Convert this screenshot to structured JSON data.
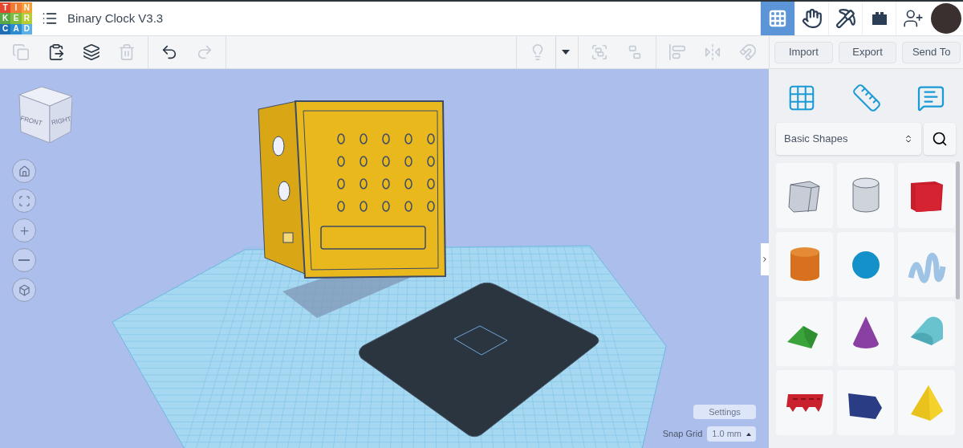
{
  "header": {
    "logo_letters": [
      {
        "text": "T",
        "color": "#e4462e"
      },
      {
        "text": "I",
        "color": "#f07c33"
      },
      {
        "text": "N",
        "color": "#f59e38"
      },
      {
        "text": "K",
        "color": "#5aa845"
      },
      {
        "text": "E",
        "color": "#7dbd3f"
      },
      {
        "text": "R",
        "color": "#b7cc35"
      },
      {
        "text": "C",
        "color": "#1f6fb8"
      },
      {
        "text": "A",
        "color": "#2d8bd2"
      },
      {
        "text": "D",
        "color": "#5bb0e4"
      }
    ],
    "title": "Binary Clock V3.3",
    "mode_tabs": [
      {
        "kind": "grid",
        "selected": true
      },
      {
        "kind": "sim",
        "selected": false
      },
      {
        "kind": "blocks",
        "selected": false
      },
      {
        "kind": "bricks",
        "selected": false
      },
      {
        "kind": "invite",
        "selected": false
      }
    ]
  },
  "toolbar": {
    "left_groups": [
      [
        {
          "kind": "copy",
          "disabled": true
        },
        {
          "kind": "paste",
          "disabled": false
        },
        {
          "kind": "duplicate",
          "disabled": false
        },
        {
          "kind": "delete",
          "disabled": true
        }
      ],
      [
        {
          "kind": "undo",
          "disabled": false
        },
        {
          "kind": "redo",
          "disabled": true
        }
      ]
    ],
    "right_groups": [
      [
        {
          "kind": "light",
          "disabled": true
        },
        {
          "kind": "light-menu",
          "disabled": false
        }
      ],
      [
        {
          "kind": "group",
          "disabled": true
        },
        {
          "kind": "ungroup",
          "disabled": true
        }
      ],
      [
        {
          "kind": "align",
          "disabled": true
        },
        {
          "kind": "mirror",
          "disabled": true
        },
        {
          "kind": "magnet",
          "disabled": true
        }
      ]
    ],
    "actions": [
      "Import",
      "Export",
      "Send To"
    ]
  },
  "view_cube": {
    "faces": [
      "FRONT",
      "RIGHT"
    ]
  },
  "view_controls": [
    {
      "kind": "home"
    },
    {
      "kind": "fit"
    },
    {
      "kind": "zoom-in"
    },
    {
      "kind": "zoom-out"
    },
    {
      "kind": "perspective"
    }
  ],
  "grid_settings": {
    "settings_label": "Settings",
    "snap_label": "Snap Grid",
    "snap_value": "1.0 mm"
  },
  "library": {
    "category": "Basic Shapes"
  }
}
